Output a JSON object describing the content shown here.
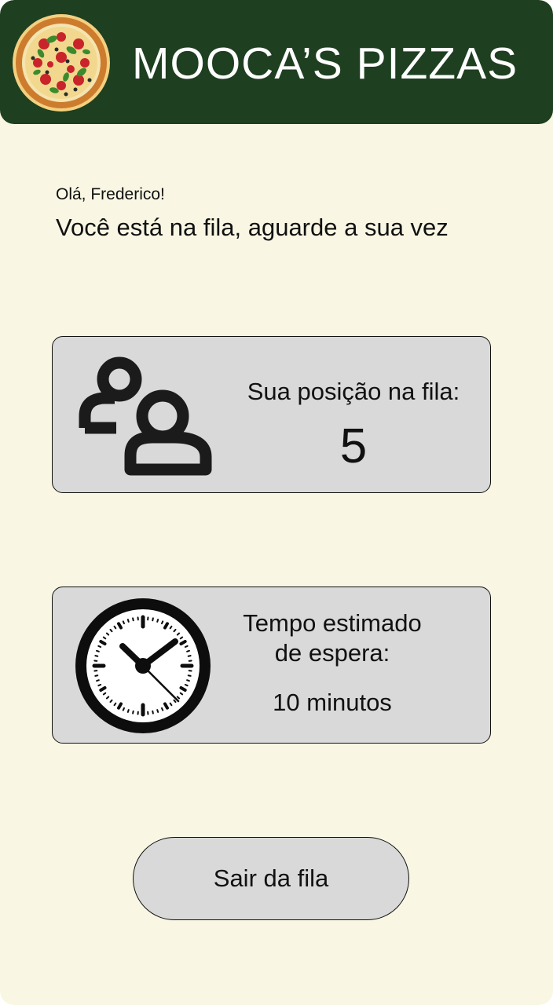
{
  "header": {
    "title": "MOOCA’S PIZZAS",
    "logo_icon": "pizza-icon",
    "background_color": "#1e3f20"
  },
  "main": {
    "greeting": "Olá, Frederico!",
    "message": "Você está na fila, aguarde a sua vez",
    "position_card": {
      "icon": "users-icon",
      "label": "Sua posição na fila:",
      "value": "5"
    },
    "wait_card": {
      "icon": "clock-icon",
      "label": "Tempo estimado\nde espera:",
      "value": "10 minutos"
    },
    "leave_button_label": "Sair da fila"
  },
  "colors": {
    "page_background": "#f9f7e4",
    "card_background": "#d9d9d9",
    "text": "#111111"
  }
}
